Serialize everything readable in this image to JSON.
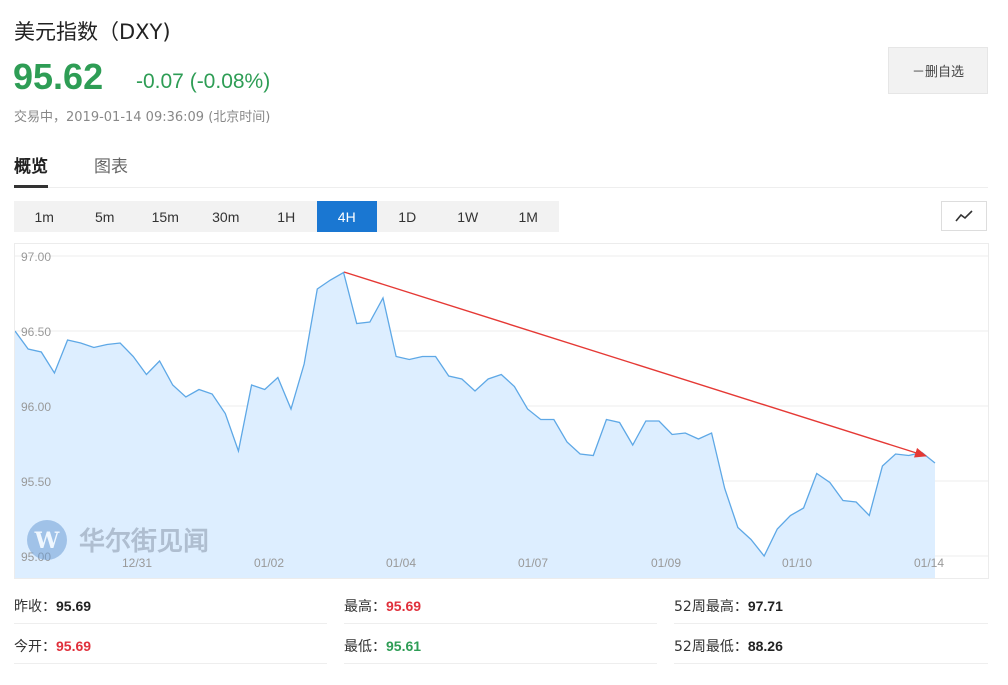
{
  "header": {
    "title": "美元指数（DXY)",
    "price": "95.62",
    "change": "-0.07 (-0.08%)",
    "status": "交易中，2019-01-14 09:36:09 (北京时间)",
    "remove_watchlist_label": "－删自选"
  },
  "tabs": [
    {
      "label": "概览",
      "active": true
    },
    {
      "label": "图表",
      "active": false
    }
  ],
  "intervals": [
    "1m",
    "5m",
    "15m",
    "30m",
    "1H",
    "4H",
    "1D",
    "1W",
    "1M"
  ],
  "active_interval": "4H",
  "chart_type_icon": "line-chart-icon",
  "watermark": "华尔街见闻",
  "colors": {
    "up": "#e0303b",
    "down": "#2e9d55",
    "accent": "#1a77d2",
    "line": "#5ea8e6",
    "fill": "#ddeeff",
    "arrow": "#e53935"
  },
  "chart_data": {
    "type": "area",
    "ylim": [
      95.0,
      97.0
    ],
    "yticks": [
      "97.00",
      "96.50",
      "96.00",
      "95.50",
      "95.00"
    ],
    "xticks": [
      "12/31",
      "01/02",
      "01/04",
      "01/07",
      "01/09",
      "01/10",
      "01/14"
    ],
    "values": [
      96.5,
      96.38,
      96.36,
      96.22,
      96.44,
      96.42,
      96.39,
      96.41,
      96.42,
      96.33,
      96.21,
      96.3,
      96.14,
      96.06,
      96.11,
      96.08,
      95.95,
      95.7,
      96.14,
      96.11,
      96.19,
      95.98,
      96.28,
      96.78,
      96.84,
      96.89,
      96.55,
      96.56,
      96.72,
      96.33,
      96.31,
      96.33,
      96.33,
      96.2,
      96.18,
      96.1,
      96.18,
      96.21,
      96.13,
      95.98,
      95.91,
      95.91,
      95.76,
      95.68,
      95.67,
      95.91,
      95.89,
      95.74,
      95.9,
      95.9,
      95.81,
      95.82,
      95.78,
      95.82,
      95.45,
      95.19,
      95.11,
      95.0,
      95.18,
      95.27,
      95.32,
      95.55,
      95.49,
      95.37,
      95.36,
      95.27,
      95.6,
      95.68,
      95.67,
      95.69,
      95.62
    ],
    "annotation": "downward trend arrow"
  },
  "stats": [
    {
      "label": "昨收：",
      "value": "95.69",
      "color": "dark"
    },
    {
      "label": "最高：",
      "value": "95.69",
      "color": "red"
    },
    {
      "label": "52周最高：",
      "value": "97.71",
      "color": "dark"
    },
    {
      "label": "今开：",
      "value": "95.69",
      "color": "red"
    },
    {
      "label": "最低：",
      "value": "95.61",
      "color": "green"
    },
    {
      "label": "52周最低：",
      "value": "88.26",
      "color": "dark"
    }
  ]
}
